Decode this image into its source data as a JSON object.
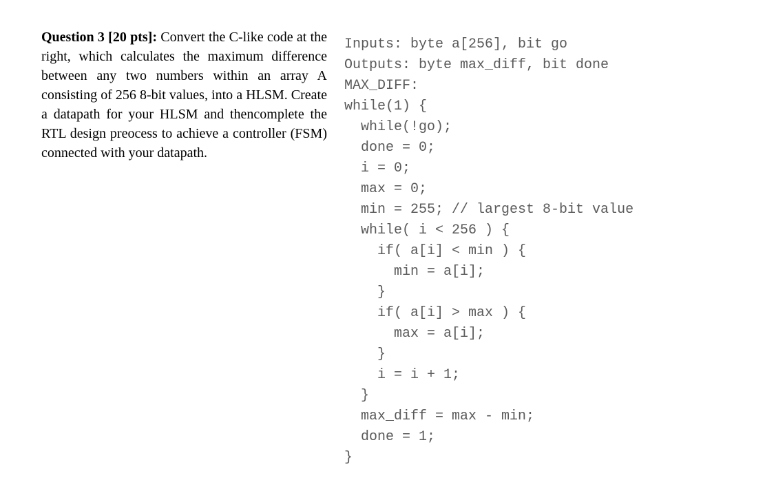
{
  "question": {
    "label": "Question 3 [20 pts]:",
    "body": " Convert the C-like code at the right, which calculates the maximum difference between any two numbers within an array A consisting of 256 8-bit values, into a HLSM. Create a datapath for your HLSM and thencomplete the RTL design preocess to achieve a controller (FSM) connected with your datapath."
  },
  "code": {
    "l01": "Inputs: byte a[256], bit go",
    "l02": "Outputs: byte max_diff, bit done",
    "l03": "MAX_DIFF:",
    "l04": "while(1) {",
    "l05": "  while(!go);",
    "l06": "  done = 0;",
    "l07": "  i = 0;",
    "l08": "  max = 0;",
    "l09": "  min = 255; // largest 8-bit value",
    "l10": "  while( i < 256 ) {",
    "l11": "    if( a[i] < min ) {",
    "l12": "      min = a[i];",
    "l13": "    }",
    "l14": "    if( a[i] > max ) {",
    "l15": "      max = a[i];",
    "l16": "    }",
    "l17": "    i = i + 1;",
    "l18": "  }",
    "l19": "  max_diff = max - min;",
    "l20": "  done = 1;",
    "l21": "}"
  }
}
